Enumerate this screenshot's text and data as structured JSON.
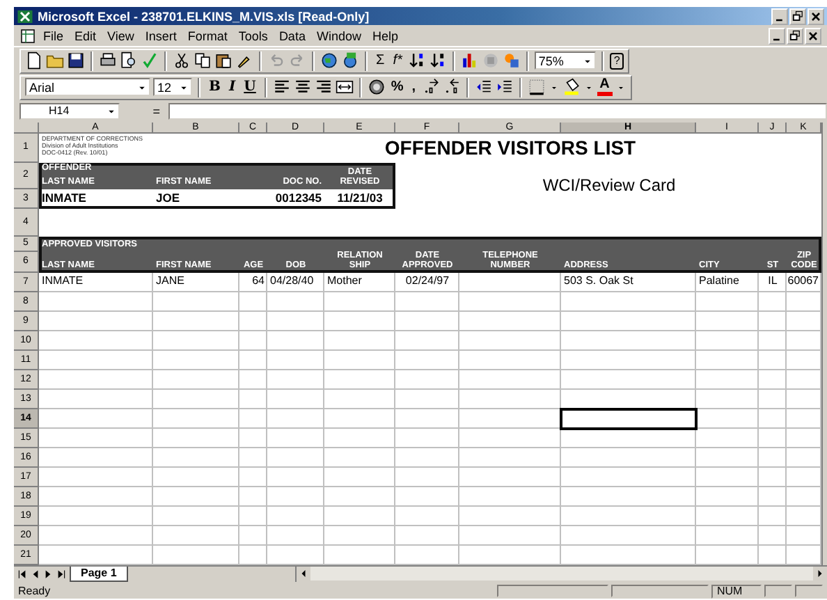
{
  "window": {
    "title": "Microsoft Excel - 238701.ELKINS_M.VIS.xls  [Read-Only]"
  },
  "menu": [
    {
      "label": "File"
    },
    {
      "label": "Edit"
    },
    {
      "label": "View"
    },
    {
      "label": "Insert"
    },
    {
      "label": "Format"
    },
    {
      "label": "Tools"
    },
    {
      "label": "Data"
    },
    {
      "label": "Window"
    },
    {
      "label": "Help"
    }
  ],
  "standard_toolbar": {
    "sum": "Σ",
    "function": "f*",
    "zoom": "75%",
    "help": "?"
  },
  "formatting_toolbar": {
    "font": "Arial",
    "size": "12",
    "bold": "B",
    "italic": "I",
    "underline": "U",
    "percent": "%",
    "comma": ",",
    "font_color": "A"
  },
  "formula_bar": {
    "name_box": "H14",
    "equals": "="
  },
  "sheet": {
    "columns": [
      {
        "label": "A",
        "selected": false
      },
      {
        "label": "B",
        "selected": false
      },
      {
        "label": "C",
        "selected": false
      },
      {
        "label": "D",
        "selected": false
      },
      {
        "label": "E",
        "selected": false
      },
      {
        "label": "F",
        "selected": false
      },
      {
        "label": "G",
        "selected": false
      },
      {
        "label": "H",
        "selected": true
      },
      {
        "label": "I",
        "selected": false
      },
      {
        "label": "J",
        "selected": false
      },
      {
        "label": "K",
        "selected": false
      }
    ],
    "rows": [
      {
        "label": "1",
        "selected": false
      },
      {
        "label": "2",
        "selected": false
      },
      {
        "label": "3",
        "selected": false
      },
      {
        "label": "4",
        "selected": false
      },
      {
        "label": "5",
        "selected": false
      },
      {
        "label": "6",
        "selected": false
      },
      {
        "label": "7",
        "selected": false
      },
      {
        "label": "8",
        "selected": false
      },
      {
        "label": "9",
        "selected": false
      },
      {
        "label": "10",
        "selected": false
      },
      {
        "label": "11",
        "selected": false
      },
      {
        "label": "12",
        "selected": false
      },
      {
        "label": "13",
        "selected": false
      },
      {
        "label": "14",
        "selected": true
      },
      {
        "label": "15",
        "selected": false
      },
      {
        "label": "16",
        "selected": false
      },
      {
        "label": "17",
        "selected": false
      },
      {
        "label": "18",
        "selected": false
      },
      {
        "label": "19",
        "selected": false
      },
      {
        "label": "20",
        "selected": false
      },
      {
        "label": "21",
        "selected": false
      }
    ],
    "department_note": "DEPARTMENT OF CORRECTIONS\nDivision of Adult Institutions\nDOC-0412 (Rev. 10/01)",
    "title": "OFFENDER VISITORS LIST",
    "subtitle": "WCI/Review Card",
    "offender": {
      "group_label": "OFFENDER",
      "columns": [
        "LAST NAME",
        "FIRST NAME",
        "DOC NO.",
        "DATE\nREVISED"
      ],
      "row": [
        "INMATE",
        "JOE",
        "0012345",
        "11/21/03"
      ]
    },
    "visitors": {
      "group_label": "APPROVED VISITORS",
      "columns": [
        "LAST NAME",
        "FIRST NAME",
        "AGE",
        "DOB",
        "RELATION\nSHIP",
        "DATE\nAPPROVED",
        "TELEPHONE\nNUMBER",
        "ADDRESS",
        "CITY",
        "ST",
        "ZIP\nCODE"
      ],
      "rows": [
        [
          "INMATE",
          "JANE",
          "64",
          "04/28/40",
          "Mother",
          "02/24/97",
          null,
          "503 S. Oak St",
          "Palatine",
          "IL",
          "60067"
        ]
      ]
    }
  },
  "sheet_tabs": [
    {
      "label": "Page 1",
      "selected": true
    }
  ],
  "status_bar": {
    "text": "Ready",
    "num": "NUM"
  }
}
